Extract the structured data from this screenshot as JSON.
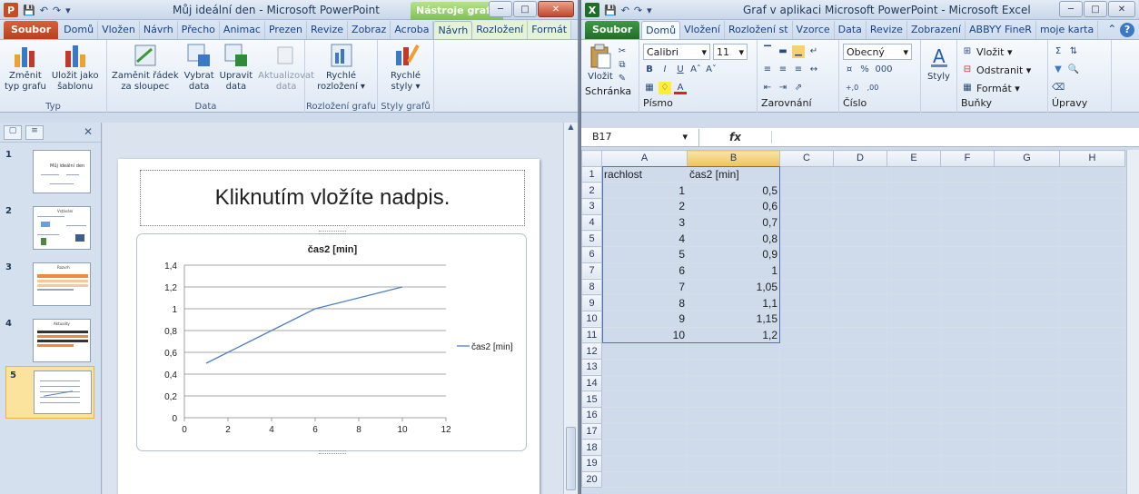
{
  "ppt": {
    "title": "Můj ideální den - Microsoft PowerPoint",
    "app_letter": "P",
    "context_badge": "Nástroje grafu",
    "tabs": [
      "Soubor",
      "Domů",
      "Vložen",
      "Návrh",
      "Přecho",
      "Animac",
      "Prezen",
      "Revize",
      "Zobraz",
      "Acroba",
      "Návrh",
      "Rozložení",
      "Formát"
    ],
    "ribbon": {
      "groups": [
        {
          "label": "Typ",
          "buttons": [
            "Změnit\ntyp grafu",
            "Uložit jako\nšablonu"
          ]
        },
        {
          "label": "Data",
          "buttons": [
            "Zaměnit řádek\nza sloupec",
            "Vybrat\ndata",
            "Upravit\ndata",
            "Aktualizovat\ndata"
          ]
        },
        {
          "label": "Rozložení grafu",
          "buttons": [
            "Rychlé\nrozložení ▾"
          ]
        },
        {
          "label": "Styly grafů",
          "buttons": [
            "Rychlé\nstyly ▾"
          ]
        }
      ]
    },
    "slides": [
      {
        "num": "1",
        "title": "Můj ideální den"
      },
      {
        "num": "2",
        "title": "Vstávání"
      },
      {
        "num": "3",
        "title": "Rozvrh"
      },
      {
        "num": "4",
        "title": "Aktuality"
      },
      {
        "num": "5",
        "title": ""
      }
    ],
    "slide_title_placeholder": "Kliknutím vložíte nadpis."
  },
  "chart_data": {
    "type": "line",
    "title": "čas2 [min]",
    "xlabel": "",
    "ylabel": "",
    "x": [
      1,
      2,
      3,
      4,
      5,
      6,
      7,
      8,
      9,
      10
    ],
    "series": [
      {
        "name": "čas2 [min]",
        "values": [
          0.5,
          0.6,
          0.7,
          0.8,
          0.9,
          1,
          1.05,
          1.1,
          1.15,
          1.2
        ]
      }
    ],
    "xlim": [
      0,
      12
    ],
    "ylim": [
      0,
      1.4
    ],
    "xticks": [
      "0",
      "2",
      "4",
      "6",
      "8",
      "10",
      "12"
    ],
    "yticks": [
      "0",
      "0,2",
      "0,4",
      "0,6",
      "0,8",
      "1",
      "1,2",
      "1,4"
    ],
    "grid": true,
    "legend": "right",
    "line_color": "#4f81bd"
  },
  "xl": {
    "title": "Graf v aplikaci Microsoft PowerPoint - Microsoft Excel",
    "app_letter": "X",
    "tabs": [
      "Soubor",
      "Domů",
      "Vložení",
      "Rozložení st",
      "Vzorce",
      "Data",
      "Revize",
      "Zobrazení",
      "ABBYY FineR",
      "moje karta"
    ],
    "font_name": "Calibri",
    "font_size": "11",
    "number_format": "Obecný",
    "paste_label": "Vložit",
    "styles_label": "Styly",
    "cells_buttons": [
      "Vložit ▾",
      "Odstranit ▾",
      "Formát ▾"
    ],
    "group_labels": [
      "Schránka",
      "Písmo",
      "Zarovnání",
      "Číslo",
      "Buňky",
      "Úpravy"
    ],
    "name_box": "B17",
    "fx": "fx",
    "columns": [
      "A",
      "B",
      "C",
      "D",
      "E",
      "F",
      "G",
      "H"
    ],
    "rows": [
      [
        "rachlost",
        "čas2 [min]"
      ],
      [
        "1",
        "0,5"
      ],
      [
        "2",
        "0,6"
      ],
      [
        "3",
        "0,7"
      ],
      [
        "4",
        "0,8"
      ],
      [
        "5",
        "0,9"
      ],
      [
        "6",
        "1"
      ],
      [
        "7",
        "1,05"
      ],
      [
        "8",
        "1,1"
      ],
      [
        "9",
        "1,15"
      ],
      [
        "10",
        "1,2"
      ]
    ],
    "row_count": 20
  }
}
